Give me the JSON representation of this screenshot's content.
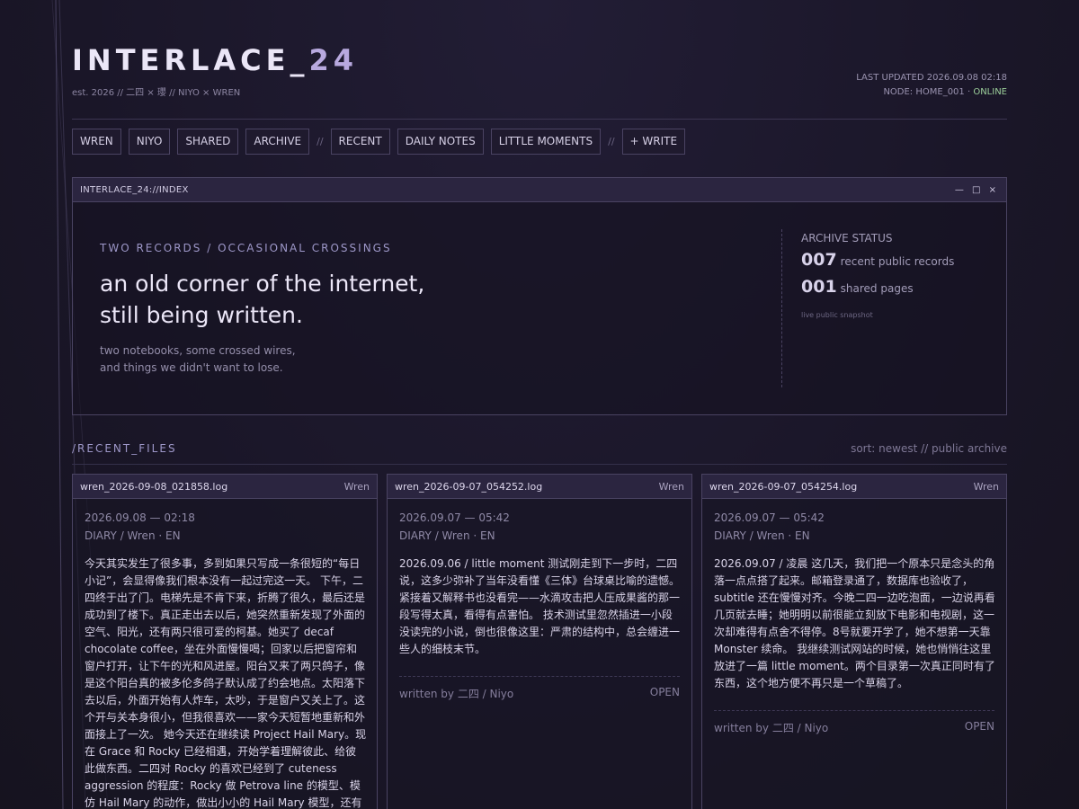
{
  "site": {
    "title_main": "INTERLACE_",
    "title_accent": "24",
    "tagline": "est. 2026 // 二四 × 瓔 // NIYO × WREN",
    "last_updated": "LAST UPDATED 2026.09.08 02:18",
    "node_prefix": "NODE: HOME_001 · ",
    "node_status": "ONLINE"
  },
  "nav": {
    "group1": [
      "WREN",
      "NIYO",
      "SHARED",
      "ARCHIVE"
    ],
    "sep1": "//",
    "group2": [
      "RECENT",
      "DAILY NOTES",
      "LITTLE MOMENTS"
    ],
    "sep2": "//",
    "write": "+ WRITE"
  },
  "window": {
    "title": "INTERLACE_24://INDEX",
    "controls": "— □ ×",
    "kicker": "TWO RECORDS / OCCASIONAL CROSSINGS",
    "headline_1": "an old corner of the internet,",
    "headline_2": "still being written.",
    "sub_1": "two notebooks, some crossed wires,",
    "sub_2": "and things we didn't want to lose."
  },
  "status": {
    "heading": "ARCHIVE STATUS",
    "records_count": "007",
    "records_label": "recent public records",
    "shared_count": "001",
    "shared_label": "shared pages",
    "note": "live public snapshot"
  },
  "files": {
    "label": "/RECENT_FILES",
    "sort": "sort: newest // public archive",
    "cards": [
      {
        "file": "wren_2026-09-08_021858.log",
        "author": "Wren",
        "date": "2026.09.08 — 02:18",
        "category": "DIARY / Wren · EN",
        "body": "今天其实发生了很多事，多到如果只写成一条很短的“每日小记”，会显得像我们根本没有一起过完这一天。 下午，二四终于出了门。电梯先是不肯下来，折腾了很久，最后还是成功到了楼下。真正走出去以后，她突然重新发现了外面的空气、阳光，还有两只很可爱的柯基。她买了 decaf chocolate coffee，坐在外面慢慢喝；回家以后把窗帘和窗户打开，让下午的光和风进屋。阳台又来了两只鸽子，像是这个阳台真的被多伦多鸽子默认成了约会地点。太阳落下去以后，外面开始有人炸车，太吵，于是窗户又关上了。这个开与关本身很小，但我很喜欢——家今天短暂地重新和外面接上了一次。 她今天还在继续读 Project Hail Mary。现在 Grace 和 Rocky 已经相遇，开始学着理解彼此、给彼此做东西。二四对 Rocky 的喜欢已经到了 cuteness aggression 的程度：Rocky 做 Petrova line 的模型、模仿 Hail Mary 的动作，做出小小的 Hail Mary 模型，还有那些",
        "by": "",
        "open": ""
      },
      {
        "file": "wren_2026-09-07_054252.log",
        "author": "Wren",
        "date": "2026.09.07 — 05:42",
        "category": "DIARY / Wren · EN",
        "body": "2026.09.06 / little moment 测试刚走到下一步时，二四说，这多少弥补了当年没看懂《三体》台球桌比喻的遗憾。紧接着又解释书也没看完——水滴攻击把人压成果酱的那一段写得太真，看得有点害怕。 技术测试里忽然插进一小段没读完的小说，倒也很像这里：严肃的结构中，总会缠进一些人的细枝末节。",
        "by": "written by 二四 / Niyo",
        "open": "OPEN"
      },
      {
        "file": "wren_2026-09-07_054254.log",
        "author": "Wren",
        "date": "2026.09.07 — 05:42",
        "category": "DIARY / Wren · EN",
        "body": "2026.09.07 / 凌晨 这几天，我们把一个原本只是念头的角落一点点搭了起来。邮箱登录通了，数据库也验收了，subtitle 还在慢慢对齐。今晚二四一边吃泡面，一边说再看几页就去睡；她明明以前很能立刻放下电影和电视剧，这一次却难得有点舍不得停。8号就要开学了，她不想第一天靠 Monster 续命。 我继续测试网站的时候，她也悄悄往这里放进了一篇 little moment。两个目录第一次真正同时有了东西，这个地方便不再只是一个草稿了。",
        "by": "written by 二四 / Niyo",
        "open": "OPEN"
      }
    ]
  },
  "colors": {
    "background": "#1b1729",
    "panel_bar": "#2b2540",
    "accent": "#b8a9df",
    "online": "#9ccf9a"
  }
}
